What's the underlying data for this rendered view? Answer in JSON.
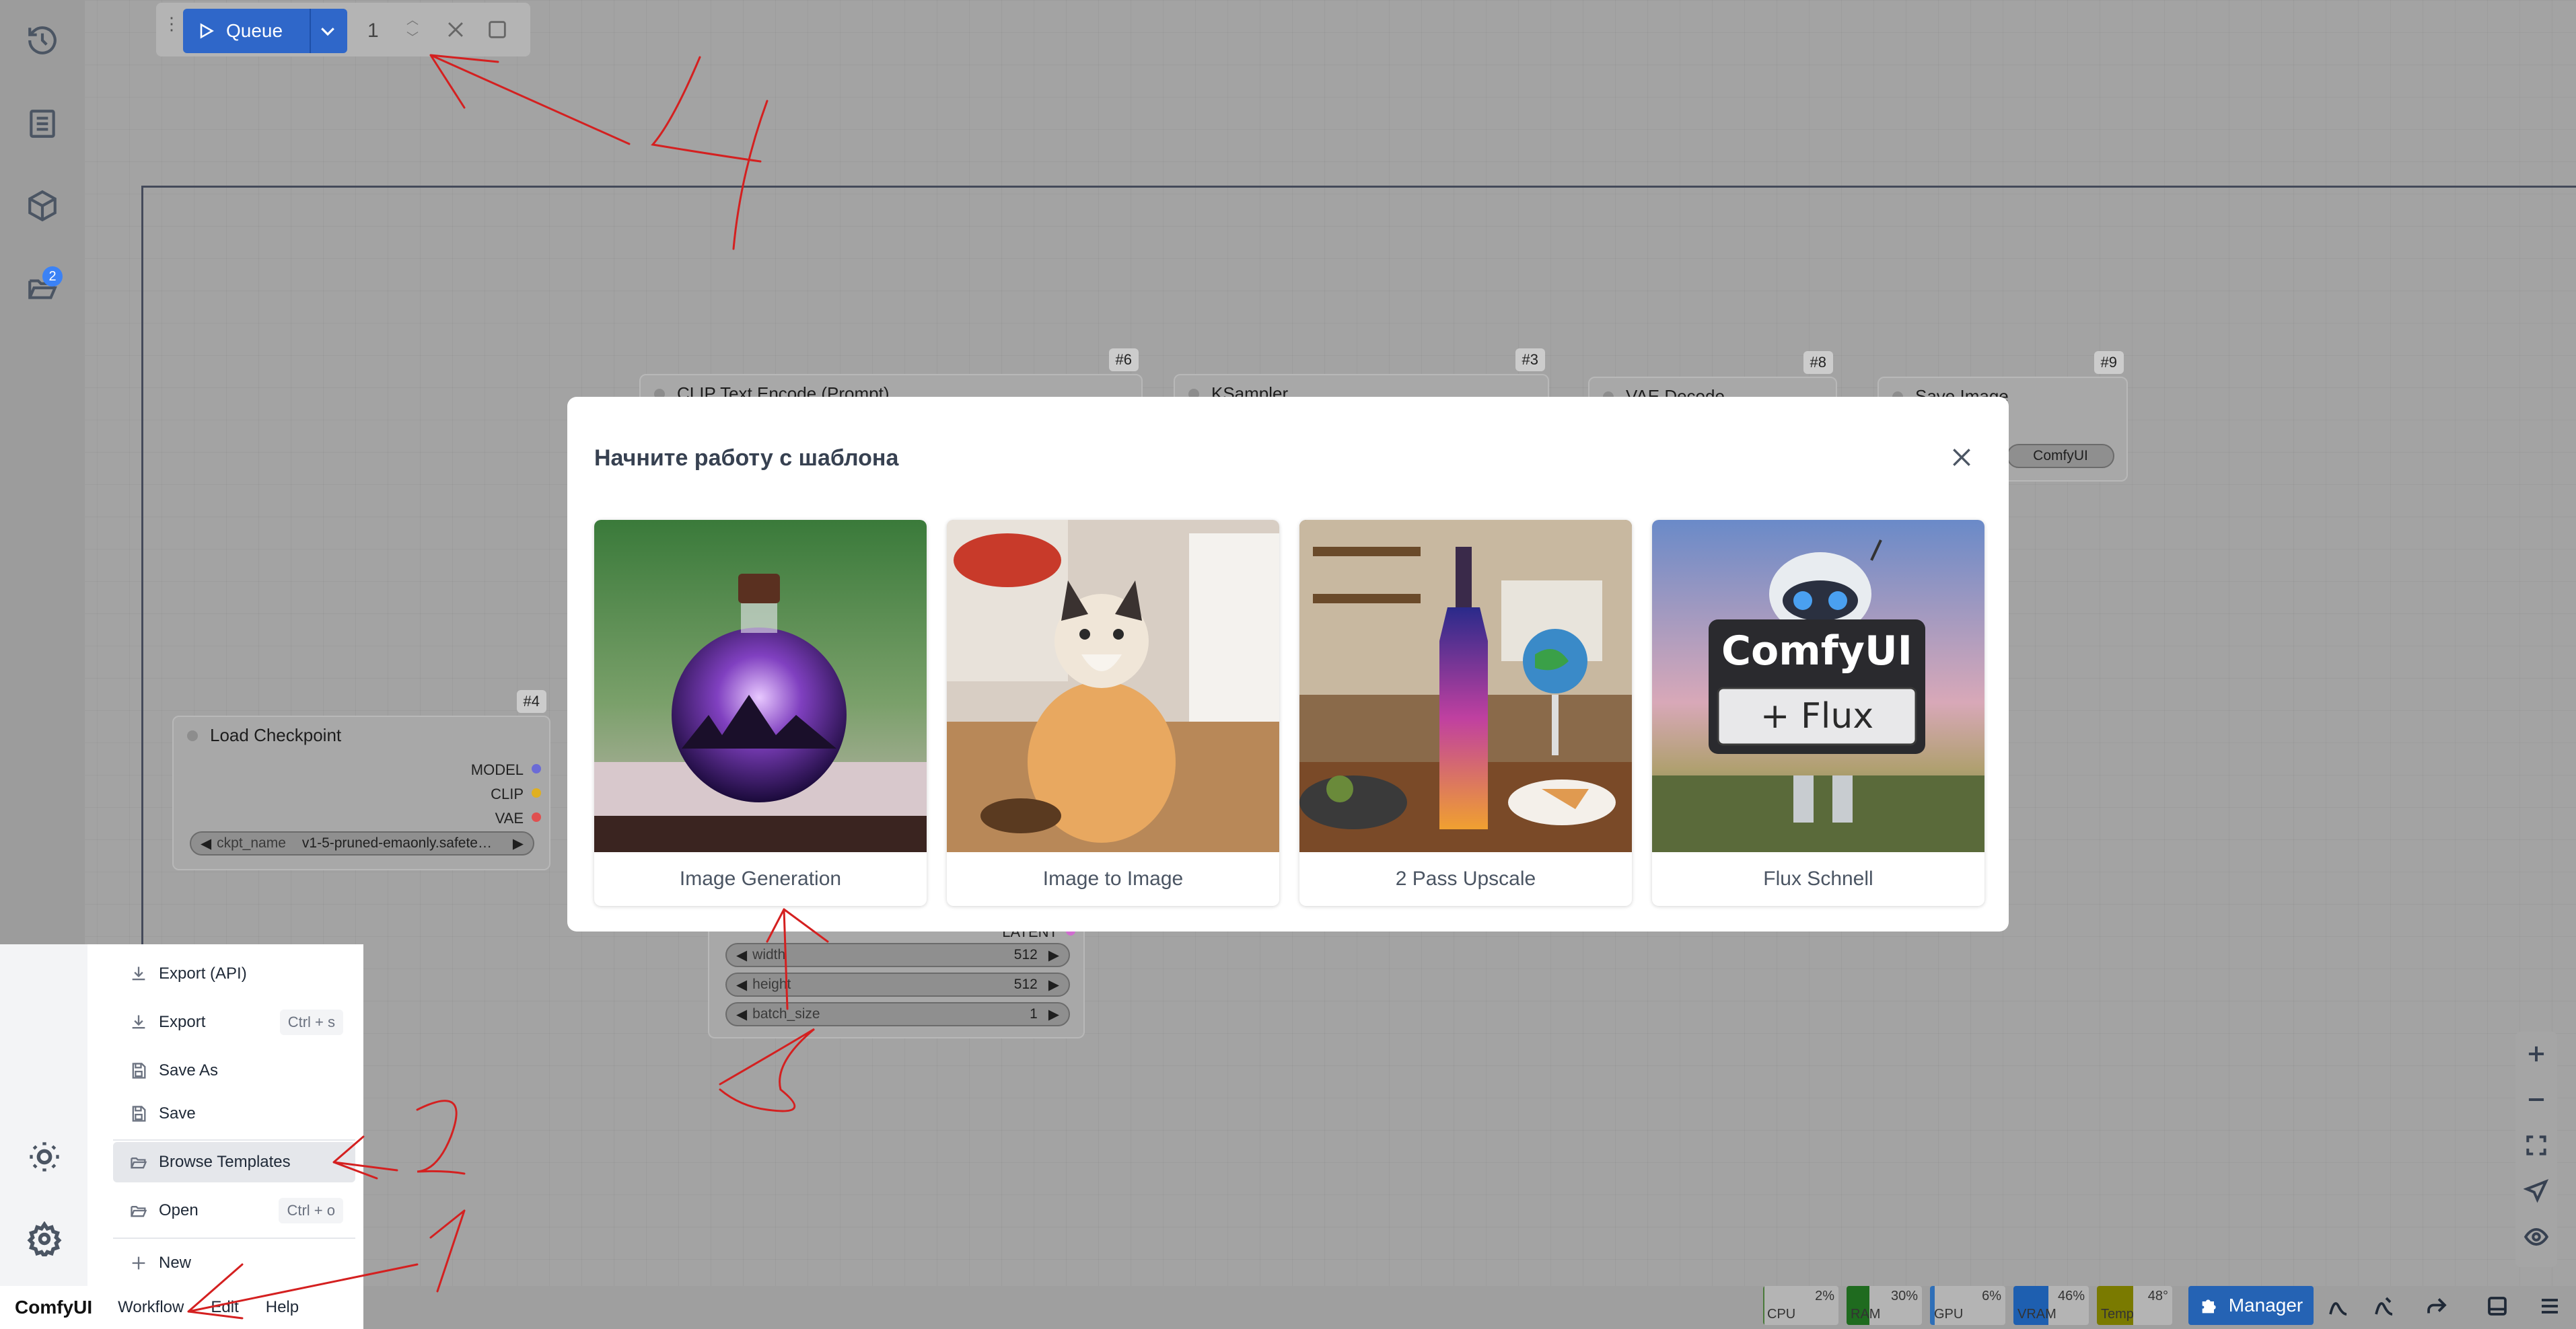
{
  "queue": {
    "label": "Queue",
    "count": "1"
  },
  "sidebar": {
    "badge": "2"
  },
  "nodes": {
    "clip": {
      "id": "#6",
      "title": "CLIP Text Encode (Prompt)"
    },
    "ksampler": {
      "id": "#3",
      "title": "KSampler"
    },
    "vae": {
      "id": "#8",
      "title": "VAE Decode"
    },
    "save": {
      "id": "#9",
      "title": "Save Image",
      "widget": "ComfyUI"
    },
    "checkpoint": {
      "id": "#4",
      "title": "Load Checkpoint",
      "outputs": [
        "MODEL",
        "CLIP",
        "VAE"
      ],
      "widget_label": "ckpt_name",
      "widget_value": "v1-5-pruned-emaonly.safete…"
    },
    "latent": {
      "output": "LATENT",
      "widgets": [
        {
          "label": "width",
          "value": "512"
        },
        {
          "label": "height",
          "value": "512"
        },
        {
          "label": "batch_size",
          "value": "1"
        }
      ]
    }
  },
  "modal": {
    "title": "Начните работу с шаблона",
    "templates": [
      {
        "label": "Image Generation"
      },
      {
        "label": "Image to Image"
      },
      {
        "label": "2 Pass Upscale"
      },
      {
        "label": "Flux Schnell",
        "image_text_1": "ComfyUI",
        "image_text_2": "+ Flux"
      }
    ]
  },
  "menu": {
    "items": [
      {
        "label": "Export (API)",
        "shortcut": ""
      },
      {
        "label": "Export",
        "shortcut": "Ctrl + s"
      },
      {
        "label": "Save As",
        "shortcut": ""
      },
      {
        "label": "Save",
        "shortcut": ""
      },
      {
        "label": "Browse Templates",
        "shortcut": ""
      },
      {
        "label": "Open",
        "shortcut": "Ctrl + o"
      },
      {
        "label": "New",
        "shortcut": ""
      }
    ]
  },
  "menubar": {
    "logo": "ComfyUI",
    "items": [
      "Workflow",
      "Edit",
      "Help"
    ]
  },
  "monitor": [
    {
      "name": "CPU",
      "value": "2%",
      "fraction": 0.02,
      "color": "#4a7a3a"
    },
    {
      "name": "RAM",
      "value": "30%",
      "fraction": 0.3,
      "color": "#1f6b1f"
    },
    {
      "name": "GPU",
      "value": "6%",
      "fraction": 0.06,
      "color": "#2f6fb8"
    },
    {
      "name": "VRAM",
      "value": "46%",
      "fraction": 0.46,
      "color": "#1e5fb0"
    },
    {
      "name": "Temp",
      "value": "48°",
      "fraction": 0.48,
      "color": "#7a7a00"
    }
  ],
  "manager": {
    "label": "Manager"
  },
  "annotations": [
    "1",
    "2",
    "3",
    "4"
  ]
}
